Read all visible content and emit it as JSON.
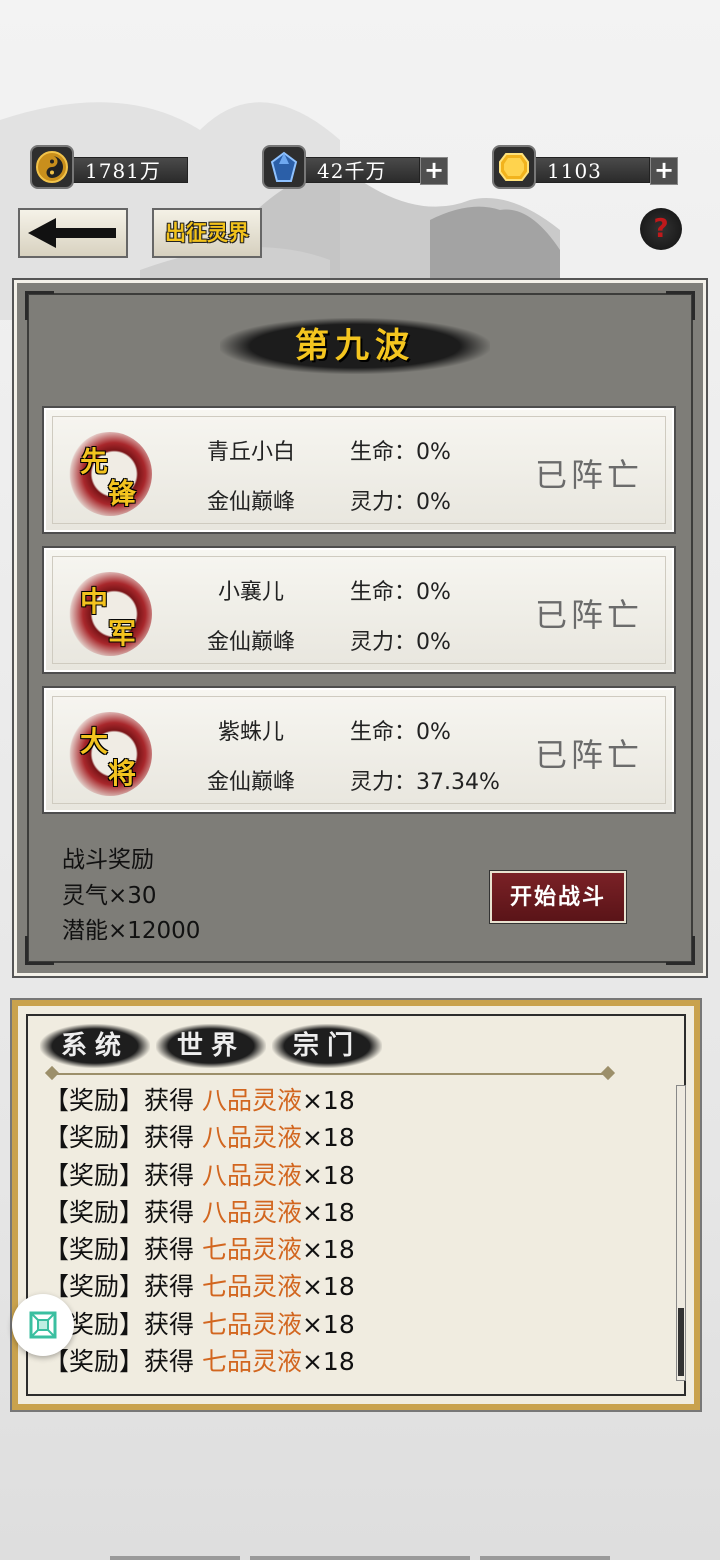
{
  "resources": {
    "copper": {
      "value": "1781万",
      "icon": "taiji-coin-icon"
    },
    "spirit_stone": {
      "value": "42千万",
      "icon": "blue-crystal-icon"
    },
    "gold": {
      "value": "1103",
      "icon": "gold-gem-icon"
    }
  },
  "nav": {
    "expedition_label": "出征灵界",
    "help_label": "?"
  },
  "wave": {
    "title": "第九波"
  },
  "enemies": [
    {
      "seal": [
        "先",
        "锋"
      ],
      "name": "青丘小白",
      "rank": "金仙巅峰",
      "hp": "生命：0%",
      "mp": "灵力：0%",
      "status": "已阵亡"
    },
    {
      "seal": [
        "中",
        "军"
      ],
      "name": "小襄儿",
      "rank": "金仙巅峰",
      "hp": "生命：0%",
      "mp": "灵力：0%",
      "status": "已阵亡"
    },
    {
      "seal": [
        "大",
        "将"
      ],
      "name": "紫蛛儿",
      "rank": "金仙巅峰",
      "hp": "生命：0%",
      "mp": "灵力：37.34%",
      "status": "已阵亡"
    }
  ],
  "rewards": {
    "title": "战斗奖励",
    "lines": [
      "灵气×30",
      "潜能×12000"
    ]
  },
  "start_button": "开始战斗",
  "log": {
    "tabs": [
      "系统",
      "世界",
      "宗门"
    ],
    "entries": [
      {
        "prefix": "【奖励】获得 ",
        "item": "八品灵液",
        "suffix": "×18"
      },
      {
        "prefix": "【奖励】获得 ",
        "item": "八品灵液",
        "suffix": "×18"
      },
      {
        "prefix": "【奖励】获得 ",
        "item": "八品灵液",
        "suffix": "×18"
      },
      {
        "prefix": "【奖励】获得 ",
        "item": "八品灵液",
        "suffix": "×18"
      },
      {
        "prefix": "【奖励】获得 ",
        "item": "七品灵液",
        "suffix": "×18"
      },
      {
        "prefix": "【奖励】获得 ",
        "item": "七品灵液",
        "suffix": "×18"
      },
      {
        "prefix": "【奖励】获得 ",
        "item": "七品灵液",
        "suffix": "×18"
      },
      {
        "prefix": "【奖励】获得 ",
        "item": "七品灵液",
        "suffix": "×18"
      }
    ]
  },
  "colors": {
    "accent_gold": "#f4c51f",
    "item_orange": "#d2661f",
    "button_red": "#6a1a1f"
  }
}
